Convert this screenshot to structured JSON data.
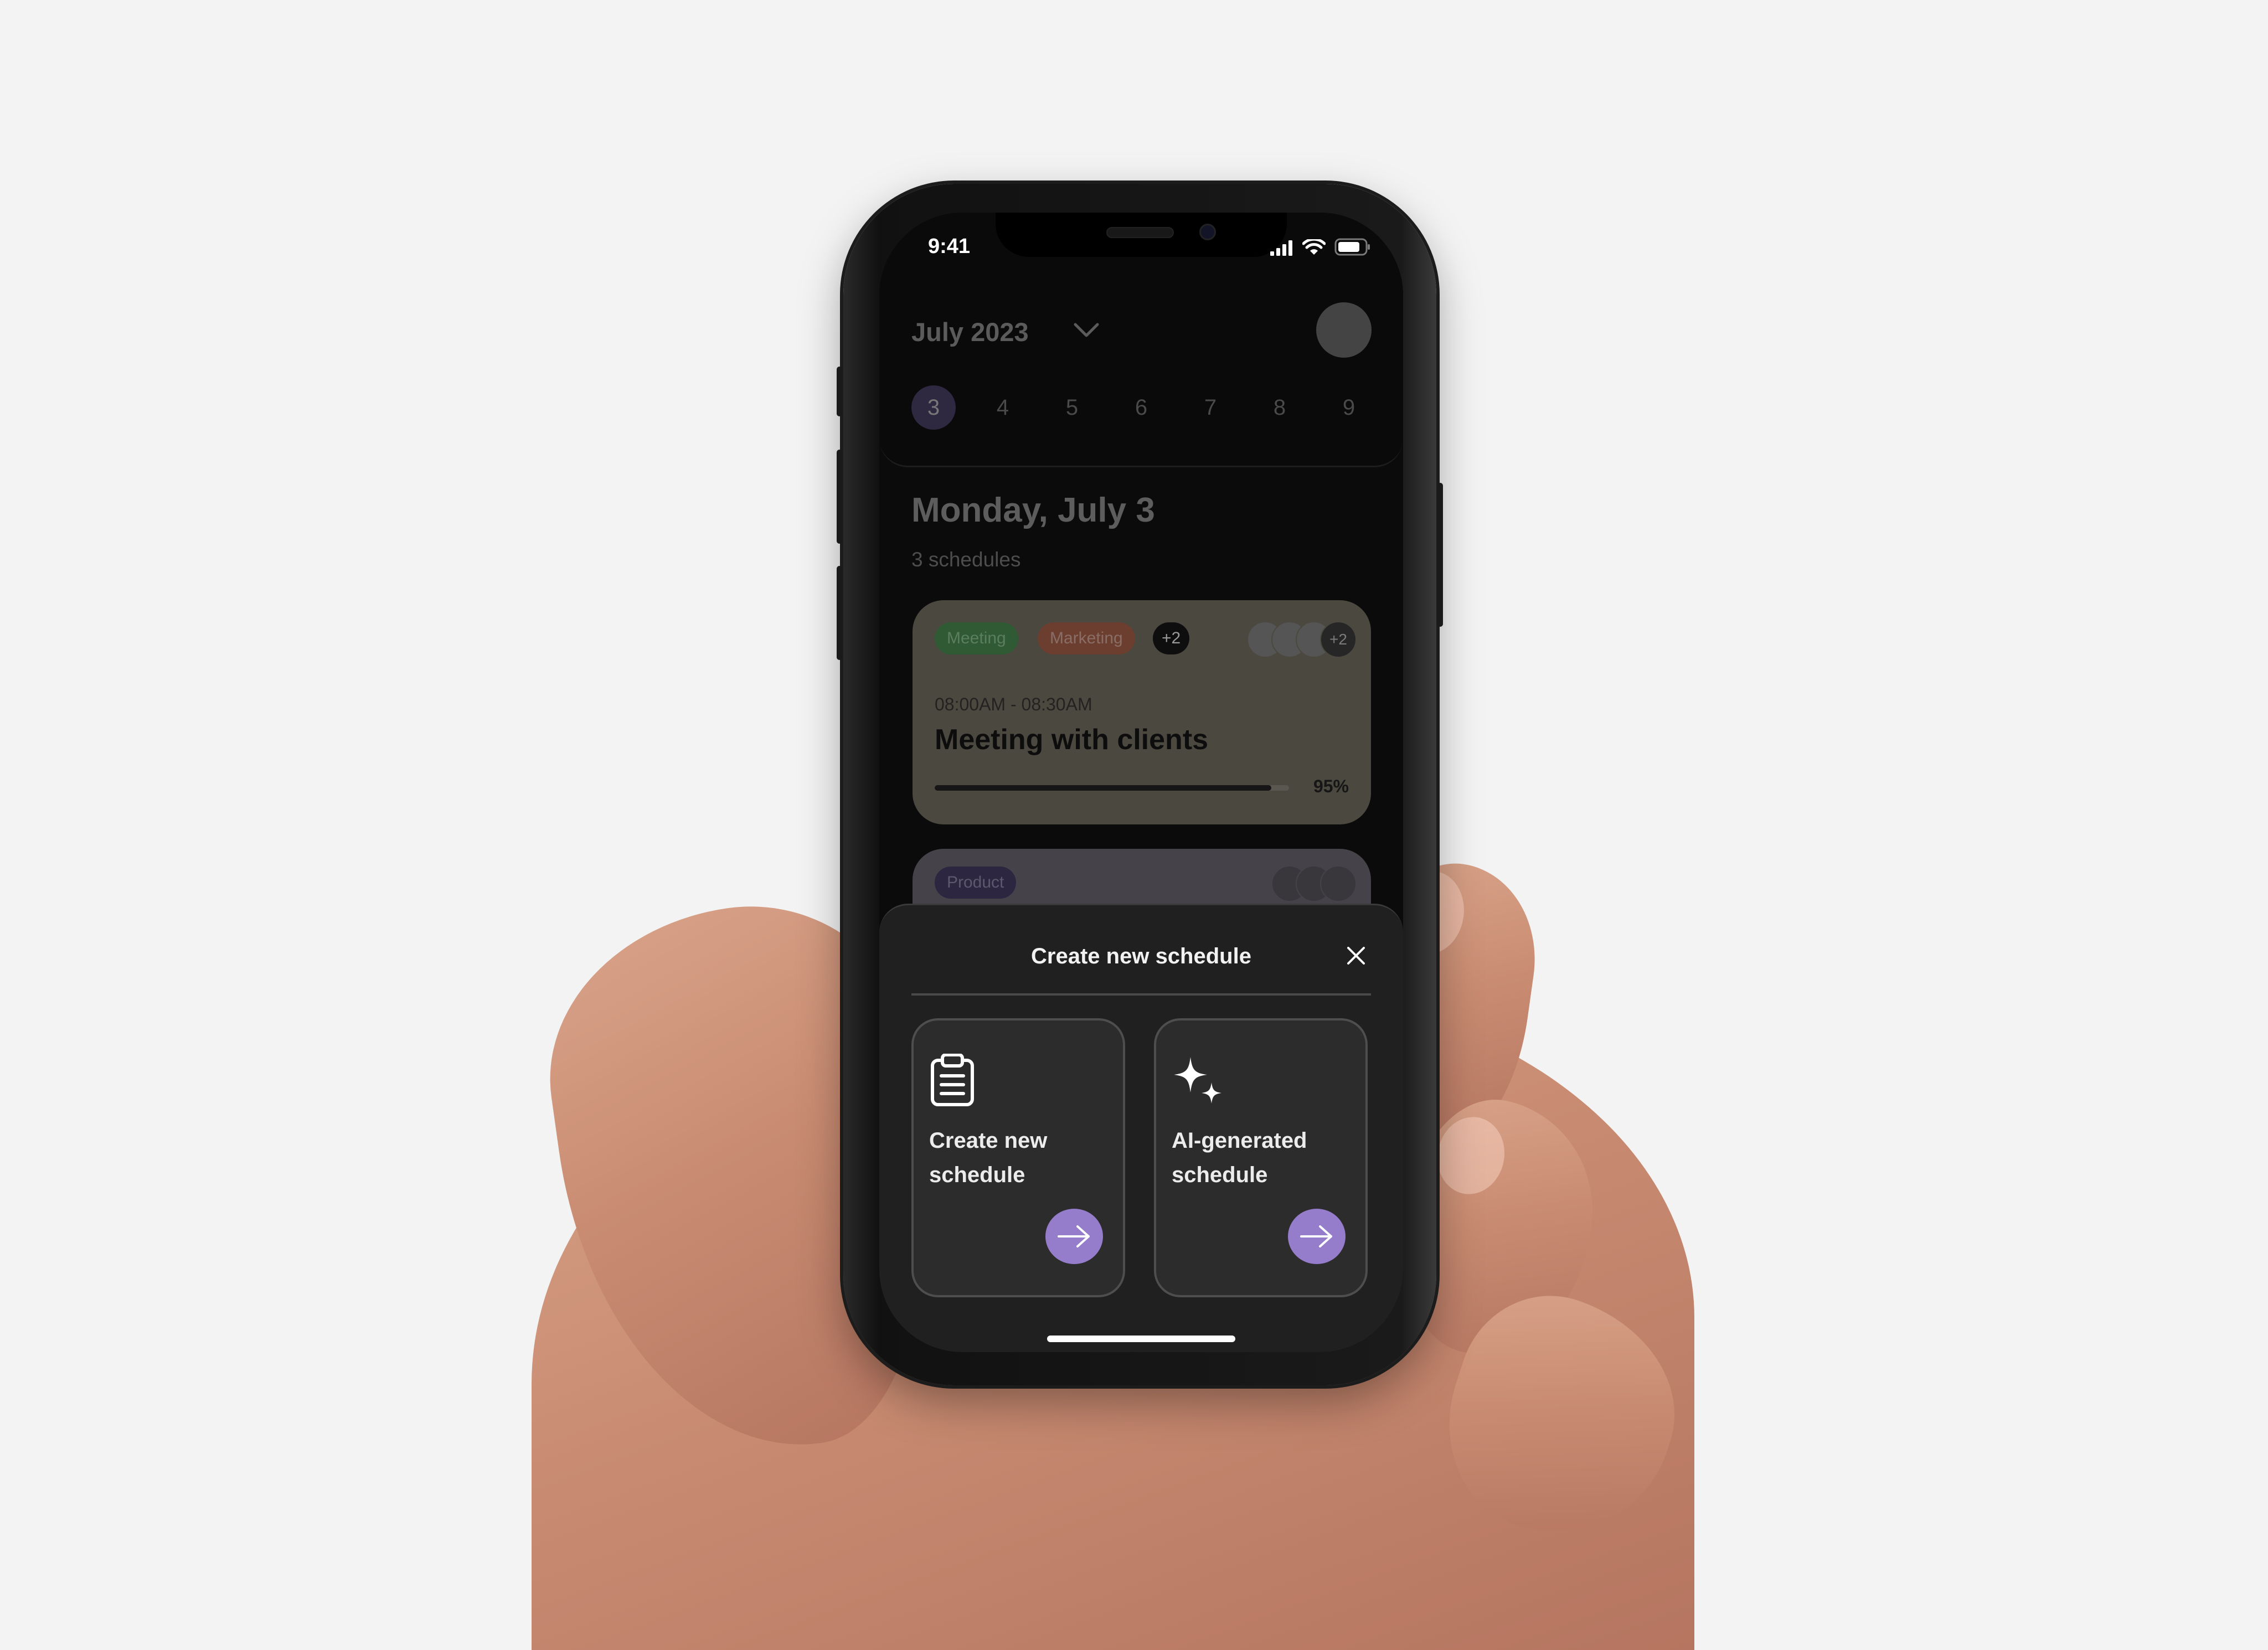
{
  "status_bar": {
    "time": "9:41",
    "icons": [
      "cellular-signal-icon",
      "wifi-icon",
      "battery-icon"
    ]
  },
  "header": {
    "month_label": "July 2023",
    "month_dropdown_icon": "chevron-down-icon",
    "avatar": "profile-avatar"
  },
  "week_days": [
    {
      "label": "3",
      "selected": true
    },
    {
      "label": "4",
      "selected": false
    },
    {
      "label": "5",
      "selected": false
    },
    {
      "label": "6",
      "selected": false
    },
    {
      "label": "7",
      "selected": false
    },
    {
      "label": "8",
      "selected": false
    },
    {
      "label": "9",
      "selected": false
    }
  ],
  "day_view": {
    "title": "Monday, July 3",
    "count_label": "3 schedules"
  },
  "schedules": [
    {
      "tags": [
        {
          "label": "Meeting",
          "color": "#2f5a33",
          "text_color": "#5c7d5e"
        },
        {
          "label": "Marketing",
          "color": "#6b3e2f",
          "text_color": "#8a6e66"
        },
        {
          "label": "+2",
          "color": "#0e0e0e",
          "text_color": "#9a9a9a"
        }
      ],
      "participants_extra": "+2",
      "time_range": "08:00AM - 08:30AM",
      "title": "Meeting with clients",
      "progress": 0.95,
      "progress_label": "95%",
      "card_color": "#4b4840"
    },
    {
      "tags": [
        {
          "label": "Product",
          "color": "#2c2640",
          "text_color": "#5d5870"
        }
      ],
      "card_color": "#46424a"
    }
  ],
  "sheet": {
    "title": "Create new schedule",
    "close_icon": "close-icon",
    "options": [
      {
        "label": "Create new schedule",
        "icon": "clipboard-icon",
        "action_icon": "arrow-right-icon"
      },
      {
        "label": "AI-generated schedule",
        "icon": "sparkles-icon",
        "action_icon": "arrow-right-icon"
      }
    ],
    "accent_color": "#957dcc"
  }
}
